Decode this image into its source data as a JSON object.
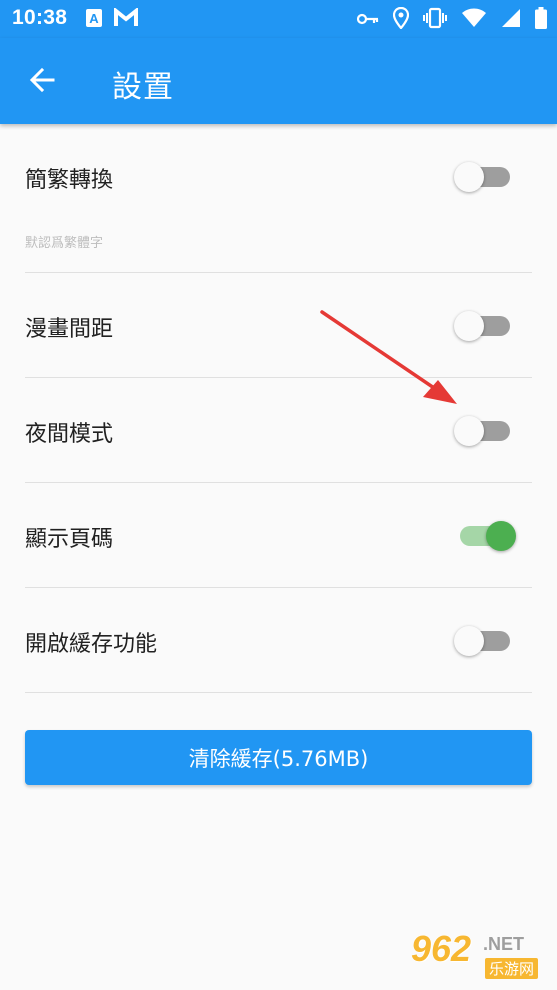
{
  "status_bar": {
    "time": "10:38",
    "left_icons": [
      "app-a-icon",
      "mail-m-icon"
    ],
    "right_icons": [
      "key-icon",
      "location-icon",
      "vibrate-icon",
      "wifi-icon",
      "signal-icon",
      "battery-icon"
    ]
  },
  "app_bar": {
    "title": "設置",
    "back_icon": "arrow-left-icon"
  },
  "settings": [
    {
      "label": "簡繁轉換",
      "subtitle": "默認爲繁體字",
      "enabled": false
    },
    {
      "label": "漫畫間距",
      "enabled": false
    },
    {
      "label": "夜間模式",
      "enabled": false
    },
    {
      "label": "顯示頁碼",
      "enabled": true
    },
    {
      "label": "開啟緩存功能",
      "enabled": false
    }
  ],
  "clear_cache_button": {
    "label": "清除緩存(5.76MB)"
  },
  "watermark": {
    "number": "962",
    "suffix": ".NET",
    "chinese": "乐游网"
  },
  "colors": {
    "primary": "#2196f3",
    "switch_on": "#4caf50",
    "switch_off": "#9e9e9e",
    "annotation_arrow": "#e53935"
  }
}
